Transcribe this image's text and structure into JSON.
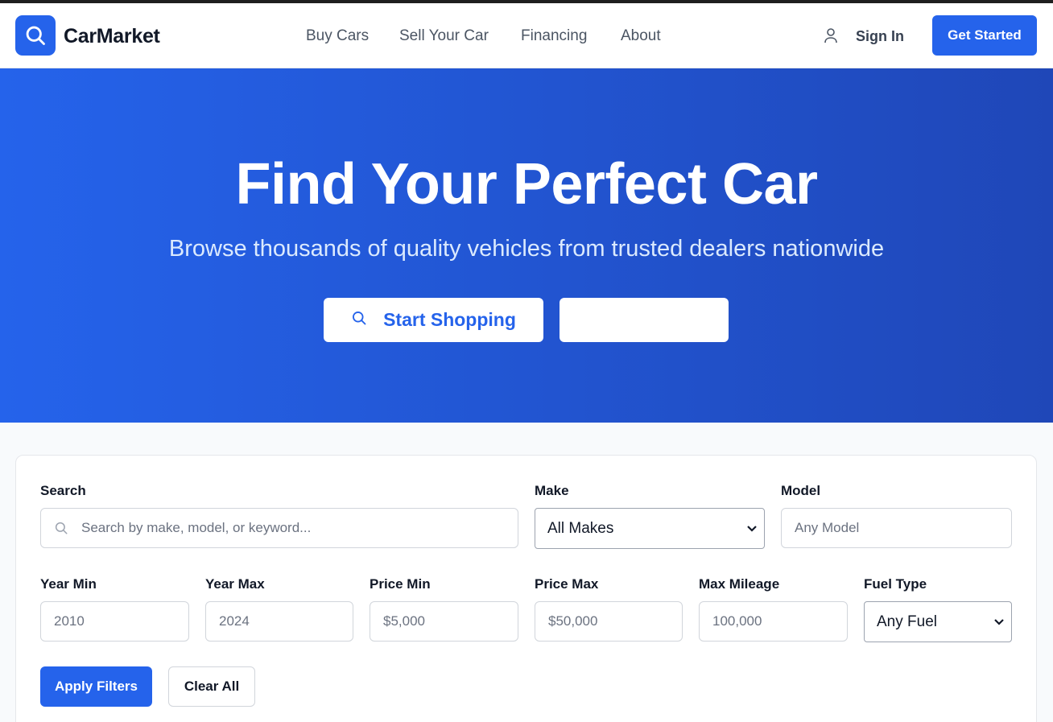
{
  "brand": {
    "name": "CarMarket",
    "accent": "#2563eb"
  },
  "nav": {
    "items": [
      "Buy Cars",
      "Sell Your Car",
      "Financing",
      "About"
    ]
  },
  "header": {
    "sign_in": "Sign In",
    "get_started": "Get Started"
  },
  "hero": {
    "title": "Find Your Perfect Car",
    "subtitle": "Browse thousands of quality vehicles from trusted dealers nationwide",
    "primary_button": "Start Shopping",
    "secondary_button": ""
  },
  "filters": {
    "search": {
      "label": "Search",
      "placeholder": "Search by make, model, or keyword..."
    },
    "make": {
      "label": "Make",
      "value": "All Makes"
    },
    "model": {
      "label": "Model",
      "placeholder": "Any Model"
    },
    "year_min": {
      "label": "Year Min",
      "placeholder": "2010"
    },
    "year_max": {
      "label": "Year Max",
      "placeholder": "2024"
    },
    "price_min": {
      "label": "Price Min",
      "placeholder": "$5,000"
    },
    "price_max": {
      "label": "Price Max",
      "placeholder": "$50,000"
    },
    "max_mileage": {
      "label": "Max Mileage",
      "placeholder": "100,000"
    },
    "fuel_type": {
      "label": "Fuel Type",
      "value": "Any Fuel"
    },
    "apply": "Apply Filters",
    "clear": "Clear All"
  }
}
